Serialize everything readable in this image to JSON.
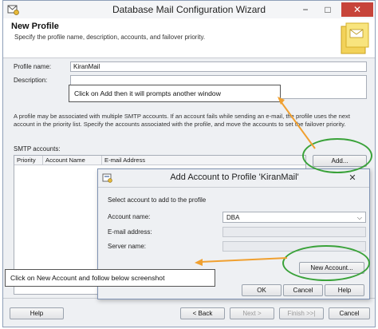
{
  "window": {
    "title": "Database Mail Configuration Wizard",
    "title_icon": "mail-wizard-icon",
    "controls": [
      "−",
      "□",
      "✕"
    ]
  },
  "header": {
    "title": "New Profile",
    "subtitle": "Specify the profile name, description, accounts, and failover priority."
  },
  "form": {
    "profile_name_label": "Profile name:",
    "profile_name_value": "KiranMail",
    "description_label": "Description:",
    "description_value": "",
    "info_line1": "A profile may be associated with multiple SMTP accounts. If an account fails while sending an e-mail, the profile uses the next",
    "info_line2": "account in the priority list. Specify the accounts associated with the profile, and move the accounts to set the failover priority.",
    "smtp_label": "SMTP accounts:",
    "columns": [
      "Priority",
      "Account Name",
      "E-mail Address"
    ],
    "add_button": "Add..."
  },
  "footer": {
    "help": "Help",
    "back": "< Back",
    "next": "Next >",
    "finish": "Finish >>|",
    "cancel": "Cancel"
  },
  "dialog": {
    "title": "Add Account to Profile 'KiranMail'",
    "instruction": "Select account to add to the profile",
    "account_name_label": "Account name:",
    "account_name_value": "DBA",
    "email_label": "E-mail address:",
    "server_label": "Server name:",
    "new_account_button": "New Account...",
    "ok": "OK",
    "cancel": "Cancel",
    "help": "Help"
  },
  "annotations": {
    "callout_top": "Click on Add then it will prompts another window",
    "callout_bottom": "Click on New Account and follow below screenshot",
    "arrow_color": "#f0a030",
    "ring_color": "#3aa23a"
  }
}
